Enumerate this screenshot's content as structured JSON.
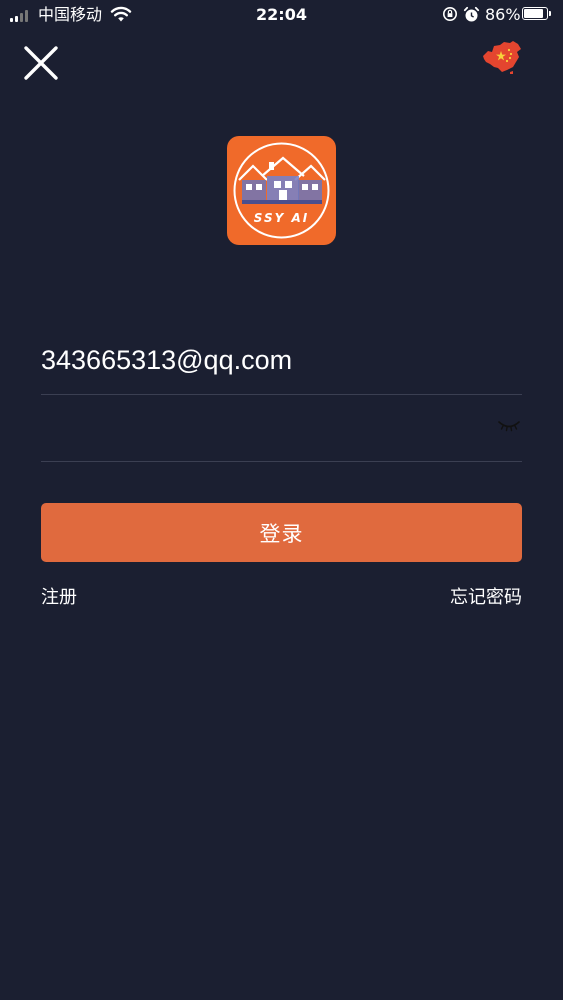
{
  "status_bar": {
    "carrier": "中国移动",
    "time": "22:04",
    "battery_percent": "86%",
    "battery_level": 0.86,
    "icons": [
      "signal-icon",
      "wifi-icon",
      "rotation-lock-icon",
      "alarm-icon",
      "battery-icon"
    ]
  },
  "nav": {
    "close_icon": "close-icon",
    "region_icon": "china-map-icon"
  },
  "logo": {
    "text": "SSY AI",
    "background": "#f06a2a"
  },
  "form": {
    "email_value": "343665313@qq.com",
    "password_value": "",
    "eye_icon": "eye-closed-icon"
  },
  "actions": {
    "login_label": "登录",
    "register_label": "注册",
    "forgot_label": "忘记密码"
  },
  "colors": {
    "background": "#1b1f31",
    "accent": "#e06a3e",
    "divider": "#3b3f52",
    "region_flag": "#e4452f"
  }
}
